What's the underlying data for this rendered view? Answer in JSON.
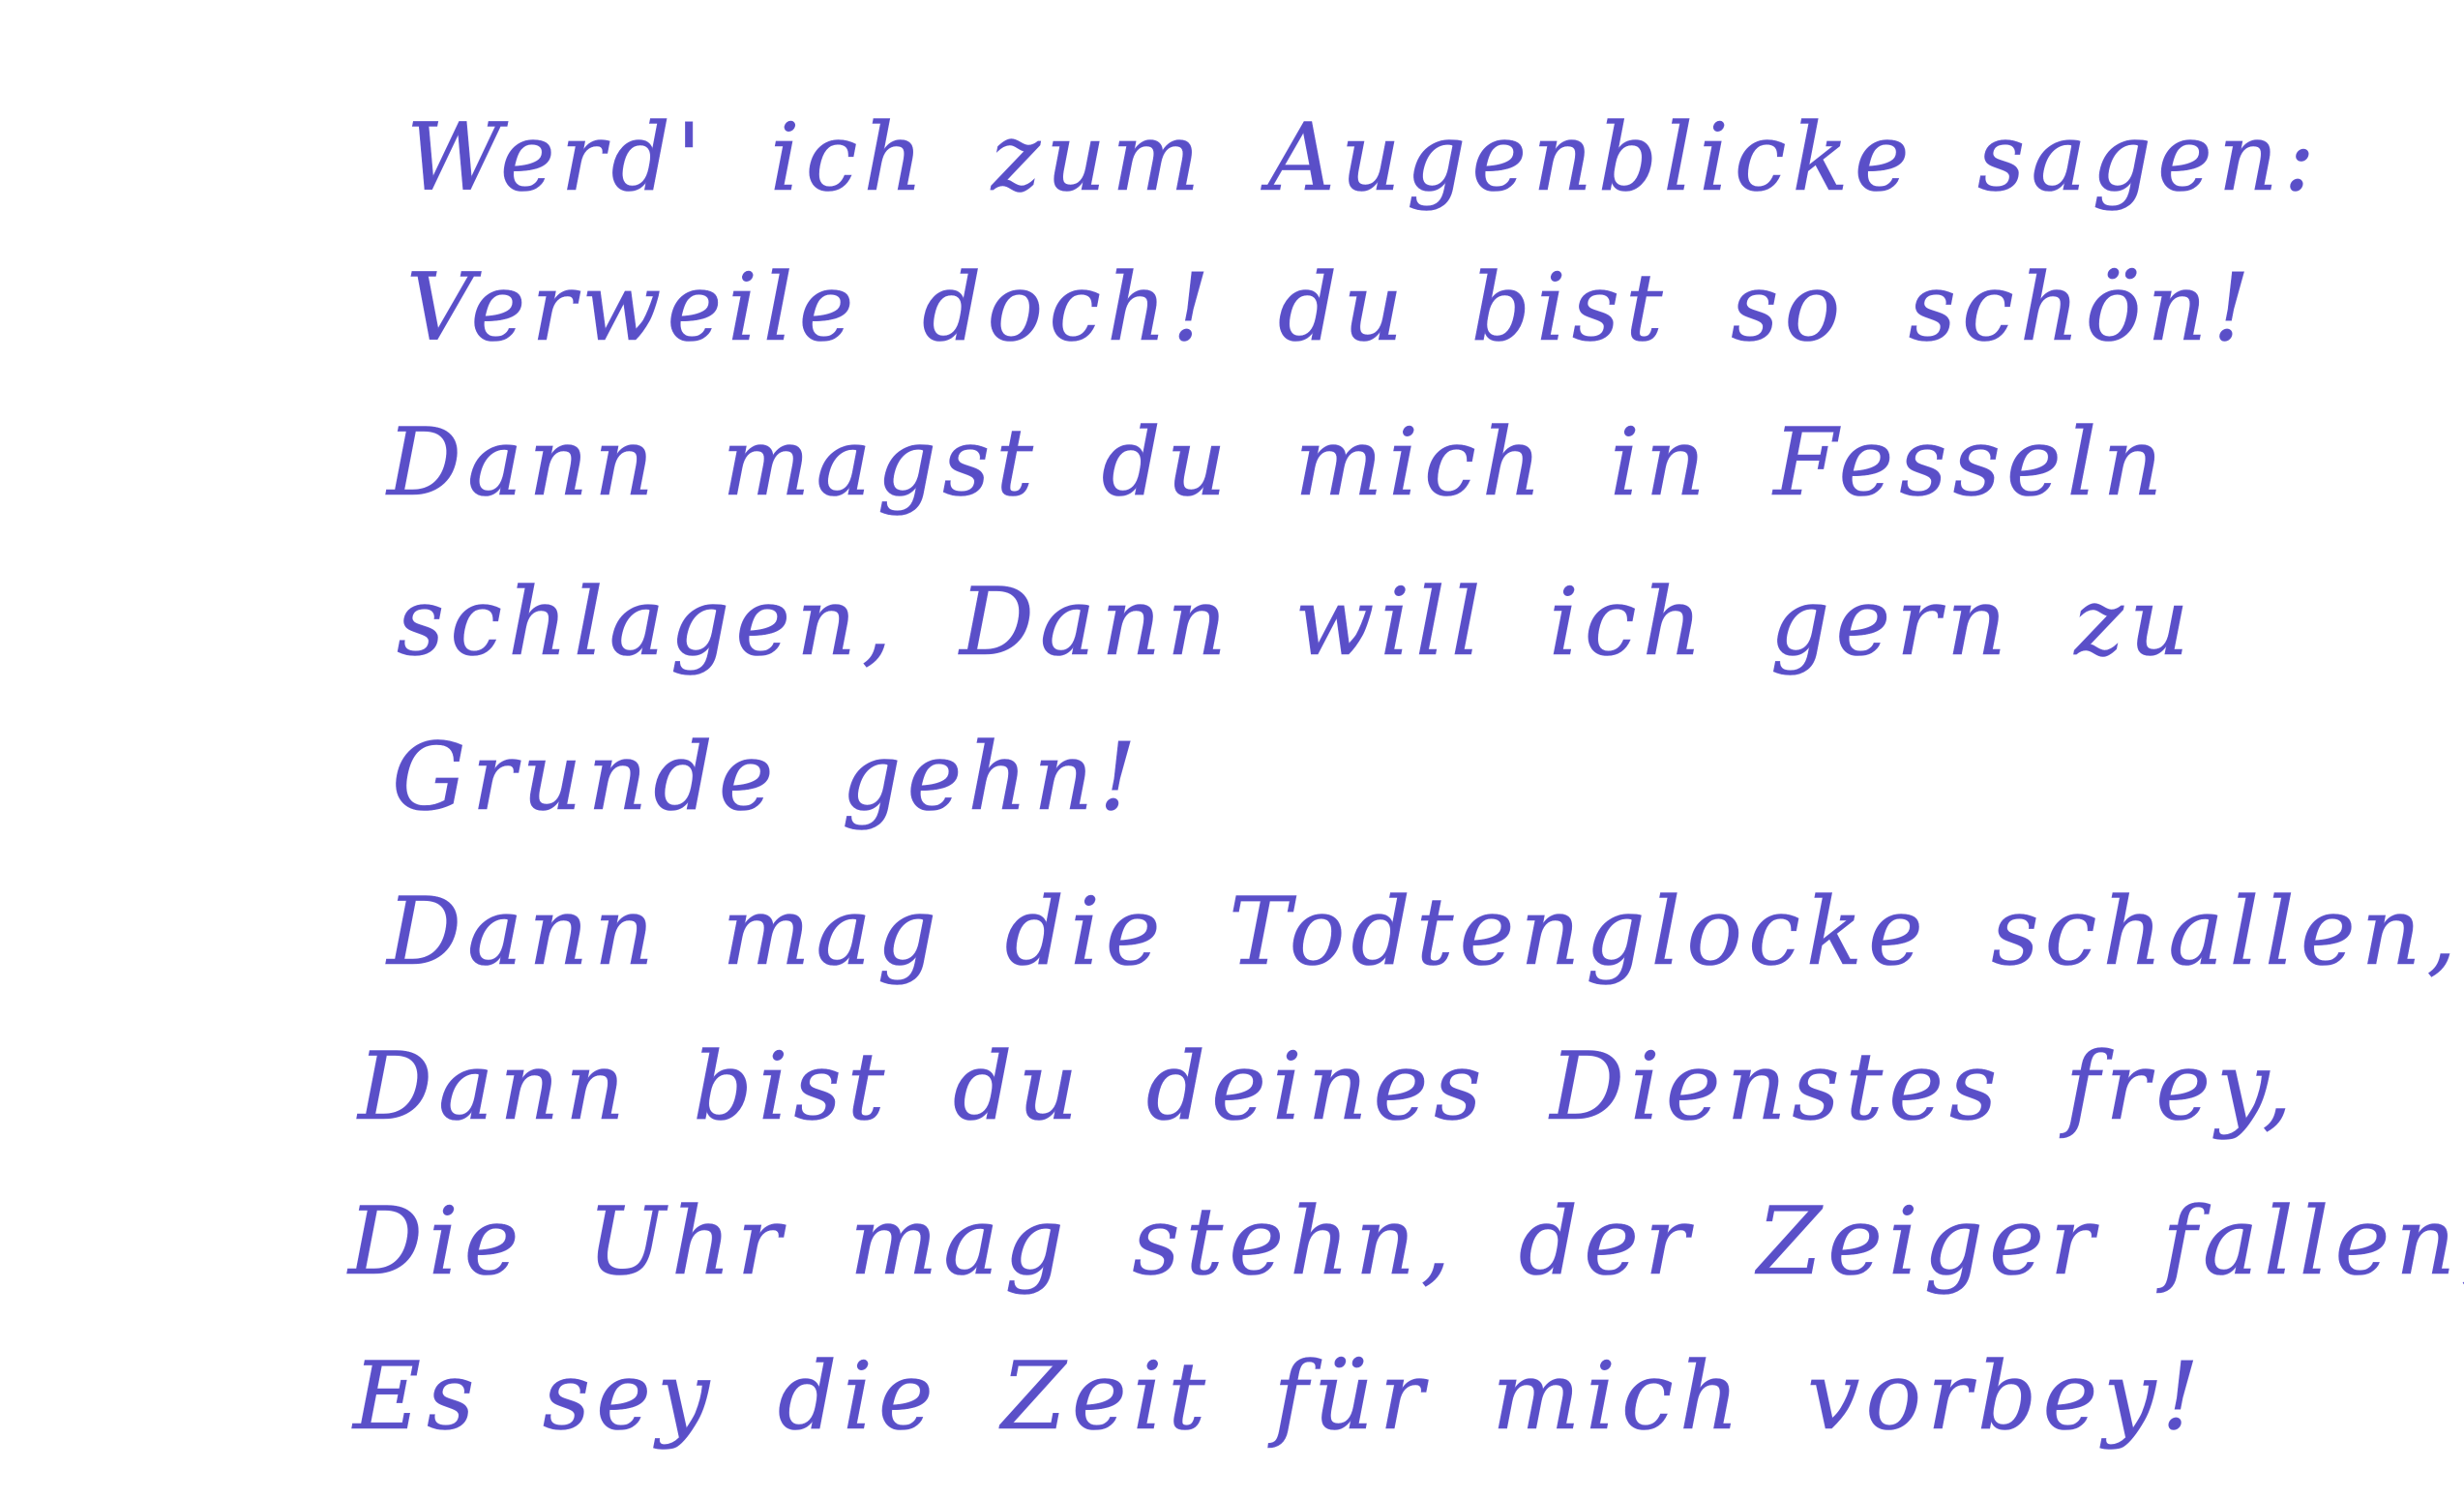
{
  "poem": {
    "lines": [
      "Werd' ich zum Augenblicke sagen:",
      "Verweile doch! du bist so schön!",
      "Dann magst du mich in Fesseln",
      "schlagen, Dann will ich gern zu",
      "Grunde gehn!",
      "Dann mag die Todtenglocke schallen,",
      "Dann bist du deines Dienstes frey,",
      "Die Uhr mag stehn, der Zeiger fallen,",
      "Es sey die Zeit für mich vorbey!"
    ]
  },
  "ink_color": "#5a4fc8"
}
